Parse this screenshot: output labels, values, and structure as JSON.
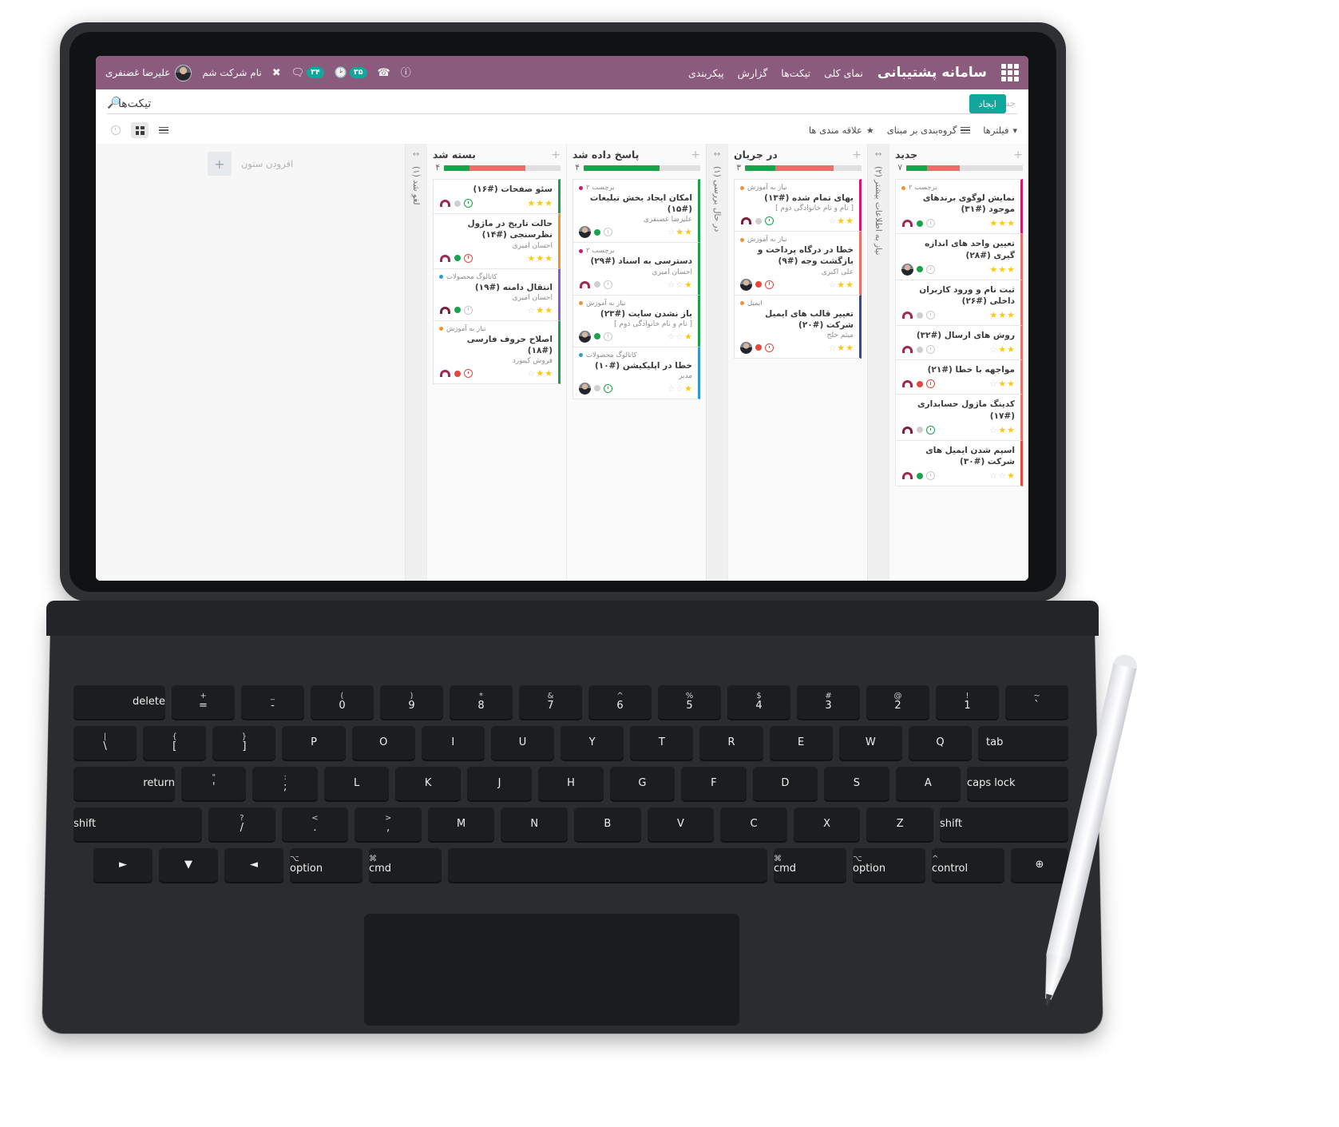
{
  "header": {
    "brand": "سامانه پشتیبانی",
    "launcher_icon": "grid-apps-icon",
    "nav": [
      {
        "label": "نمای کلی"
      },
      {
        "label": "تیکت‌ها"
      },
      {
        "label": "گزارش"
      },
      {
        "label": "پیکربندی"
      }
    ],
    "user_name": "علیرضا غضنفری",
    "company_name": "نام شرکت شم",
    "icons": {
      "shortcut": "scissors-icon",
      "messages_badge": "۳۴",
      "messages": "chat-bubble-icon",
      "activity_badge": "۳۵",
      "activity": "clock-icon",
      "phone": "phone-icon",
      "help": "question-circle-icon"
    }
  },
  "search": {
    "placeholder": "جستجو...",
    "value": "",
    "icon": "search-icon"
  },
  "toolbar": {
    "filters_label": "فیلترها",
    "filters_icon": "funnel-icon",
    "groupby_label": "گروه‌بندی بر مبنای",
    "groupby_icon": "hamburger-icon",
    "favorites_label": "علاقه مندی ها",
    "favorites_icon": "star-icon",
    "view_kanban_icon": "kanban-grid-icon",
    "view_list_icon": "list-view-icon",
    "view_activity_icon": "clock-view-icon"
  },
  "page": {
    "title": "تیکت‌ها",
    "create_label": "ایجاد"
  },
  "board": {
    "add_column_label": "افزودن ستون",
    "add_column_icon": "plus-icon",
    "collapsed_columns": [
      {
        "label": "نیاز به اطلاعات بیشتر (۲)",
        "arrows_icon": "expand-arrows-icon"
      },
      {
        "label": "در حال بررسی (۱)",
        "arrows_icon": "expand-arrows-icon"
      },
      {
        "label": "لغو شد (۱)",
        "arrows_icon": "expand-arrows-icon"
      }
    ],
    "columns": [
      {
        "title": "جدید",
        "count": "۷",
        "add_icon": "plus-icon",
        "bar": [
          {
            "color": "#e0e0e0",
            "pct": 54
          },
          {
            "color": "#e8706a",
            "pct": 28
          },
          {
            "color": "#19a34a",
            "pct": 18
          }
        ],
        "cards": [
          {
            "tag": "برچسب ۲",
            "tag_color": "#f0932b",
            "title": "نمایش لوگوی برندهای موجود (#۳۱)",
            "sub": "",
            "accent": "#d6156b",
            "avatar": "headset",
            "dot": "#19a34a",
            "clock": "grey",
            "stars": [
              1,
              1,
              1
            ]
          },
          {
            "tag": "",
            "tag_color": "",
            "title": "تعیین واحد های اندازه گیری (#۲۸)",
            "sub": "",
            "accent": "#e8706a",
            "avatar": "person",
            "dot": "#19a34a",
            "clock": "grey",
            "stars": [
              1,
              1,
              1
            ]
          },
          {
            "tag": "",
            "tag_color": "",
            "title": "ثبت نام و ورود کاربران داخلی (#۲۶)",
            "sub": "",
            "accent": "#e8706a",
            "avatar": "headset",
            "dot": "#cfcfcf",
            "clock": "grey",
            "stars": [
              1,
              1,
              1
            ]
          },
          {
            "tag": "",
            "tag_color": "",
            "title": "روش های ارسال (#۳۲)",
            "sub": "",
            "accent": "#e8706a",
            "avatar": "headset",
            "dot": "#cfcfcf",
            "clock": "grey",
            "stars": [
              0,
              1,
              1
            ]
          },
          {
            "tag": "",
            "tag_color": "",
            "title": "مواجهه با خطا (#۲۱)",
            "sub": "",
            "accent": "#e8706a",
            "avatar": "headset",
            "dot": "#e8453c",
            "clock": "red",
            "stars": [
              0,
              1,
              1
            ]
          },
          {
            "tag": "",
            "tag_color": "",
            "title": "کدینگ ماژول حسابداری (#۱۷)",
            "sub": "",
            "accent": "#e8706a",
            "avatar": "headset-dark",
            "dot": "#cfcfcf",
            "clock": "green",
            "stars": [
              0,
              1,
              1
            ]
          },
          {
            "tag": "",
            "tag_color": "",
            "title": "اسپم شدن ایمیل های شرکت (#۳۰)",
            "sub": "",
            "accent": "#e8453c",
            "avatar": "headset",
            "dot": "#19a34a",
            "clock": "grey",
            "stars": [
              0,
              0,
              1
            ]
          }
        ]
      },
      {
        "title": "در جریان",
        "count": "۳",
        "add_icon": "plus-icon",
        "bar": [
          {
            "color": "#e0e0e0",
            "pct": 24
          },
          {
            "color": "#e8706a",
            "pct": 50
          },
          {
            "color": "#19a34a",
            "pct": 26
          }
        ],
        "cards": [
          {
            "tag": "نیاز به آموزش",
            "tag_color": "#f0932b",
            "title": "بهای تمام شده (#۱۳)",
            "sub": "[ نام و نام خانوادگی دوم ]",
            "accent": "#d6156b",
            "avatar": "headset-dark",
            "dot": "#cfcfcf",
            "clock": "green",
            "stars": [
              0,
              1,
              1
            ]
          },
          {
            "tag": "نیاز به آموزش",
            "tag_color": "#f0932b",
            "title": "خطا در درگاه پرداخت و بازگشت وجه (#۹)",
            "sub": "علی اکبری",
            "accent": "#e8706a",
            "avatar": "person",
            "dot": "#e8453c",
            "clock": "red",
            "stars": [
              0,
              1,
              1
            ]
          },
          {
            "tag": "ایمیل",
            "tag_color": "#f0932b",
            "title": "تغییر قالب های ایمیل شرکت (#۲۰)",
            "sub": "میثم خلج",
            "accent": "#3b4a77",
            "avatar": "person",
            "dot": "#e8453c",
            "clock": "red",
            "stars": [
              0,
              1,
              1
            ]
          }
        ]
      },
      {
        "title": "پاسخ داده شد",
        "count": "۴",
        "add_icon": "plus-icon",
        "bar": [
          {
            "color": "#e0e0e0",
            "pct": 35
          },
          {
            "color": "#19a34a",
            "pct": 65
          }
        ],
        "cards": [
          {
            "tag": "برچسب ۲",
            "tag_color": "#d6156b",
            "title": "امکان ایجاد بخش تبلیغات (#۱۵)",
            "sub": "علیرضا غضنفری",
            "accent": "#19a34a",
            "avatar": "person",
            "dot": "#19a34a",
            "clock": "grey",
            "stars": [
              0,
              1,
              1
            ]
          },
          {
            "tag": "برچسب ۲",
            "tag_color": "#d6156b",
            "title": "دسترسی به اسناد (#۲۹)",
            "sub": "احسان امیری",
            "accent": "#19a34a",
            "avatar": "headset",
            "dot": "#cfcfcf",
            "clock": "grey",
            "stars": [
              0,
              0,
              1
            ]
          },
          {
            "tag": "نیاز به آموزش",
            "tag_color": "#f0932b",
            "title": "باز نشدن سایت (#۲۳)",
            "sub": "[ نام و نام خانوادگی دوم ]",
            "accent": "#19a34a",
            "avatar": "person",
            "dot": "#19a34a",
            "clock": "grey",
            "stars": [
              0,
              0,
              1
            ]
          },
          {
            "tag": "کاتالوگ محصولات",
            "tag_color": "#2e9bd6",
            "title": "خطا در اپلیکیشن (#۱۰)",
            "sub": "مدیر",
            "accent": "#2e9bd6",
            "avatar": "person",
            "dot": "#cfcfcf",
            "clock": "green",
            "stars": [
              0,
              0,
              1
            ]
          }
        ]
      },
      {
        "title": "بسته شد",
        "count": "۴",
        "add_icon": "plus-icon",
        "bar": [
          {
            "color": "#e0e0e0",
            "pct": 30
          },
          {
            "color": "#e8706a",
            "pct": 48
          },
          {
            "color": "#19a34a",
            "pct": 22
          }
        ],
        "cards": [
          {
            "tag": "",
            "tag_color": "",
            "title": "سئو صفحات (#۱۶)",
            "sub": "",
            "accent": "#19a34a",
            "avatar": "headset",
            "dot": "#cfcfcf",
            "clock": "green",
            "stars": [
              1,
              1,
              1
            ]
          },
          {
            "tag": "",
            "tag_color": "",
            "title": "حالت تاریخ در ماژول نظرسنجی (#۱۴)",
            "sub": "احسان امیری",
            "accent": "#f0932b",
            "avatar": "headset",
            "dot": "#19a34a",
            "clock": "red",
            "stars": [
              1,
              1,
              1
            ]
          },
          {
            "tag": "کاتالوگ محصولات",
            "tag_color": "#2e9bd6",
            "title": "انتقال دامنه (#۱۹)",
            "sub": "احسان امیری",
            "accent": "#8b5bd6",
            "avatar": "headset-dark",
            "dot": "#19a34a",
            "clock": "grey",
            "stars": [
              0,
              1,
              1
            ]
          },
          {
            "tag": "نیاز به آموزش",
            "tag_color": "#f0932b",
            "title": "اصلاح حروف فارسی (#۱۸)",
            "sub": "فروش کیبورد",
            "accent": "#19a34a",
            "avatar": "headset",
            "dot": "#e8453c",
            "clock": "red",
            "stars": [
              0,
              1,
              1
            ]
          }
        ]
      }
    ]
  },
  "keyboard": {
    "rows": [
      [
        {
          "top": "~",
          "main": "`"
        },
        {
          "top": "!",
          "main": "1"
        },
        {
          "top": "@",
          "main": "2"
        },
        {
          "top": "#",
          "main": "3"
        },
        {
          "top": "$",
          "main": "4"
        },
        {
          "top": "%",
          "main": "5"
        },
        {
          "top": "^",
          "main": "6"
        },
        {
          "top": "&",
          "main": "7"
        },
        {
          "top": "*",
          "main": "8"
        },
        {
          "top": "(",
          "main": "9"
        },
        {
          "top": ")",
          "main": "0"
        },
        {
          "top": "_",
          "main": "-"
        },
        {
          "top": "+",
          "main": "="
        },
        {
          "top": "",
          "main": "delete"
        }
      ],
      [
        {
          "top": "",
          "main": "tab"
        },
        {
          "top": "",
          "main": "Q"
        },
        {
          "top": "",
          "main": "W"
        },
        {
          "top": "",
          "main": "E"
        },
        {
          "top": "",
          "main": "R"
        },
        {
          "top": "",
          "main": "T"
        },
        {
          "top": "",
          "main": "Y"
        },
        {
          "top": "",
          "main": "U"
        },
        {
          "top": "",
          "main": "I"
        },
        {
          "top": "",
          "main": "O"
        },
        {
          "top": "",
          "main": "P"
        },
        {
          "top": "{",
          "main": "["
        },
        {
          "top": "}",
          "main": "]"
        },
        {
          "top": "|",
          "main": "\\"
        }
      ],
      [
        {
          "top": "",
          "main": "caps lock"
        },
        {
          "top": "",
          "main": "A"
        },
        {
          "top": "",
          "main": "S"
        },
        {
          "top": "",
          "main": "D"
        },
        {
          "top": "",
          "main": "F"
        },
        {
          "top": "",
          "main": "G"
        },
        {
          "top": "",
          "main": "H"
        },
        {
          "top": "",
          "main": "J"
        },
        {
          "top": "",
          "main": "K"
        },
        {
          "top": "",
          "main": "L"
        },
        {
          "top": ":",
          "main": ";"
        },
        {
          "top": "\"",
          "main": "'"
        },
        {
          "top": "",
          "main": "return"
        }
      ],
      [
        {
          "top": "",
          "main": "shift"
        },
        {
          "top": "",
          "main": "Z"
        },
        {
          "top": "",
          "main": "X"
        },
        {
          "top": "",
          "main": "C"
        },
        {
          "top": "",
          "main": "V"
        },
        {
          "top": "",
          "main": "B"
        },
        {
          "top": "",
          "main": "N"
        },
        {
          "top": "",
          "main": "M"
        },
        {
          "top": "<",
          "main": ","
        },
        {
          "top": ">",
          "main": "."
        },
        {
          "top": "?",
          "main": "/"
        },
        {
          "top": "",
          "main": "shift"
        }
      ],
      [
        {
          "top": "",
          "main": "⊕"
        },
        {
          "top": "^",
          "main": "control"
        },
        {
          "top": "⌥",
          "main": "option"
        },
        {
          "top": "⌘",
          "main": "cmd"
        },
        {
          "top": "",
          "main": ""
        },
        {
          "top": "⌘",
          "main": "cmd"
        },
        {
          "top": "⌥",
          "main": "option"
        },
        {
          "top": "",
          "main": "◄"
        },
        {
          "top": "",
          "main": "▼"
        },
        {
          "top": "",
          "main": "►"
        }
      ]
    ]
  }
}
